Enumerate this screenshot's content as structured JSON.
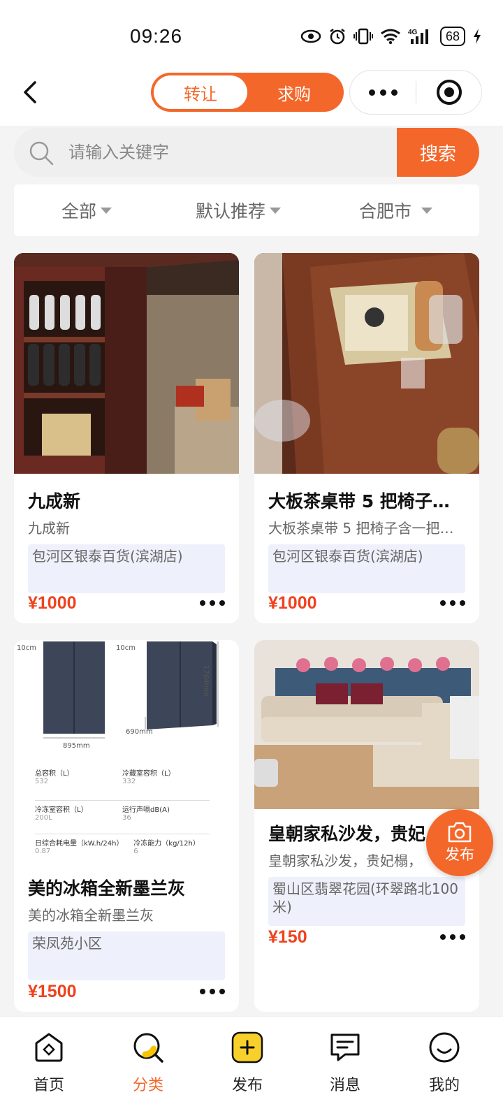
{
  "status": {
    "time": "09:26",
    "battery": "68"
  },
  "nav": {
    "tab_transfer": "转让",
    "tab_request": "求购"
  },
  "search": {
    "placeholder": "请输入关键字",
    "button": "搜索"
  },
  "filters": {
    "all": "全部",
    "sort": "默认推荐",
    "city": "合肥市"
  },
  "listings": [
    {
      "title": "九成新",
      "subtitle": "九成新",
      "location": "包河区银泰百货(滨湖店)",
      "price": "¥1000"
    },
    {
      "title": "大板茶桌带 5 把椅子…",
      "subtitle": "大板茶桌带 5 把椅子含一把…",
      "location": "包河区银泰百货(滨湖店)",
      "price": "¥1000"
    },
    {
      "title": "美的冰箱全新墨兰灰",
      "subtitle": "美的冰箱全新墨兰灰",
      "location": "荣凤苑小区",
      "price": "¥1500",
      "spec": {
        "dim_left": "10cm",
        "dim_right": "10cm",
        "width": "895mm",
        "depth": "690mm",
        "height": "1764mm",
        "rows": [
          {
            "k1": "总容积（L）",
            "v1": "532",
            "k2": "冷藏室容积（L）",
            "v2": "332"
          },
          {
            "k1": "冷冻室容积（L）",
            "v1": "200L",
            "k2": "运行声嗝dB(A)",
            "v2": "36"
          },
          {
            "k1": "日综合耗电量（kW.h/24h）",
            "v1": "0.87",
            "k2": "冷冻能力（kg/12h）",
            "v2": "6"
          }
        ]
      }
    },
    {
      "title": "皇朝家私沙发，贵妃",
      "subtitle": "皇朝家私沙发，贵妃榻，",
      "location": "蜀山区翡翠花园(环翠路北100米)",
      "price": "¥150"
    }
  ],
  "fab": {
    "label": "发布"
  },
  "tabbar": [
    {
      "label": "首页"
    },
    {
      "label": "分类"
    },
    {
      "label": "发布"
    },
    {
      "label": "消息"
    },
    {
      "label": "我的"
    }
  ],
  "colors": {
    "accent": "#f4672a",
    "price": "#f0421e",
    "location_bg": "#eef1fb"
  }
}
